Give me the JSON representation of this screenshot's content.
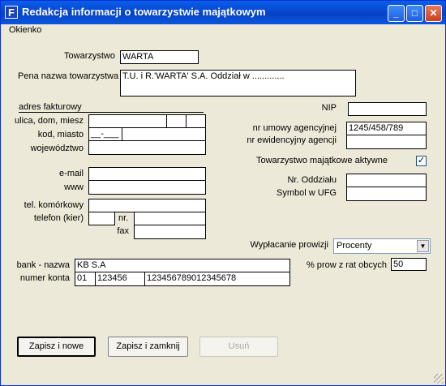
{
  "window": {
    "title": "Redakcja informacji o towarzystwie majątkowym",
    "icon": "F"
  },
  "menu": {
    "okienko": "Okienko"
  },
  "form": {
    "towarzystwo_label": "Towarzystwo",
    "towarzystwo_value": "WARTA",
    "pelna_nazwa_label": "Pena nazwa towarzystwa",
    "pelna_nazwa_value": "T.U. i R.'WARTA' S.A. Oddział w .............",
    "adres_header": "adres fakturowy",
    "ulica_label": "ulica, dom, miesz",
    "kod_label": "kod, miasto",
    "kod_value": "__-___",
    "wojewodztwo_label": "województwo",
    "email_label": "e-mail",
    "www_label": "www",
    "tel_kom_label": "tel. komórkowy",
    "telefon_label": "telefon (kier)",
    "nr_label": "nr.",
    "fax_label": "fax",
    "nip_label": "NIP",
    "nr_umowy_label": "nr umowy agencyjnej",
    "nr_umowy_value": "1245/458/789",
    "nr_ewid_label": "nr ewidencyjny agencji",
    "aktywne_label": "Towarzystwo majątkowe aktywne",
    "aktywne_checked": "✓",
    "nr_oddzialu_label": "Nr. Oddziału",
    "symbol_ufg_label": "Symbol w UFG",
    "wyplacanie_label": "Wypłacanie prowizji",
    "wyplacanie_value": "Procenty",
    "prow_label": "% prow z rat obcych",
    "prow_value": "50",
    "bank_label": "bank - nazwa",
    "bank_value": "KB S.A",
    "konto_label": "numer konta",
    "konto_part1": "01",
    "konto_part2": "123456",
    "konto_part3": "123456789012345678"
  },
  "buttons": {
    "zapisz_nowe": "Zapisz i nowe",
    "zapisz_zamknij": "Zapisz i zamknij",
    "usun": "Usuń"
  }
}
